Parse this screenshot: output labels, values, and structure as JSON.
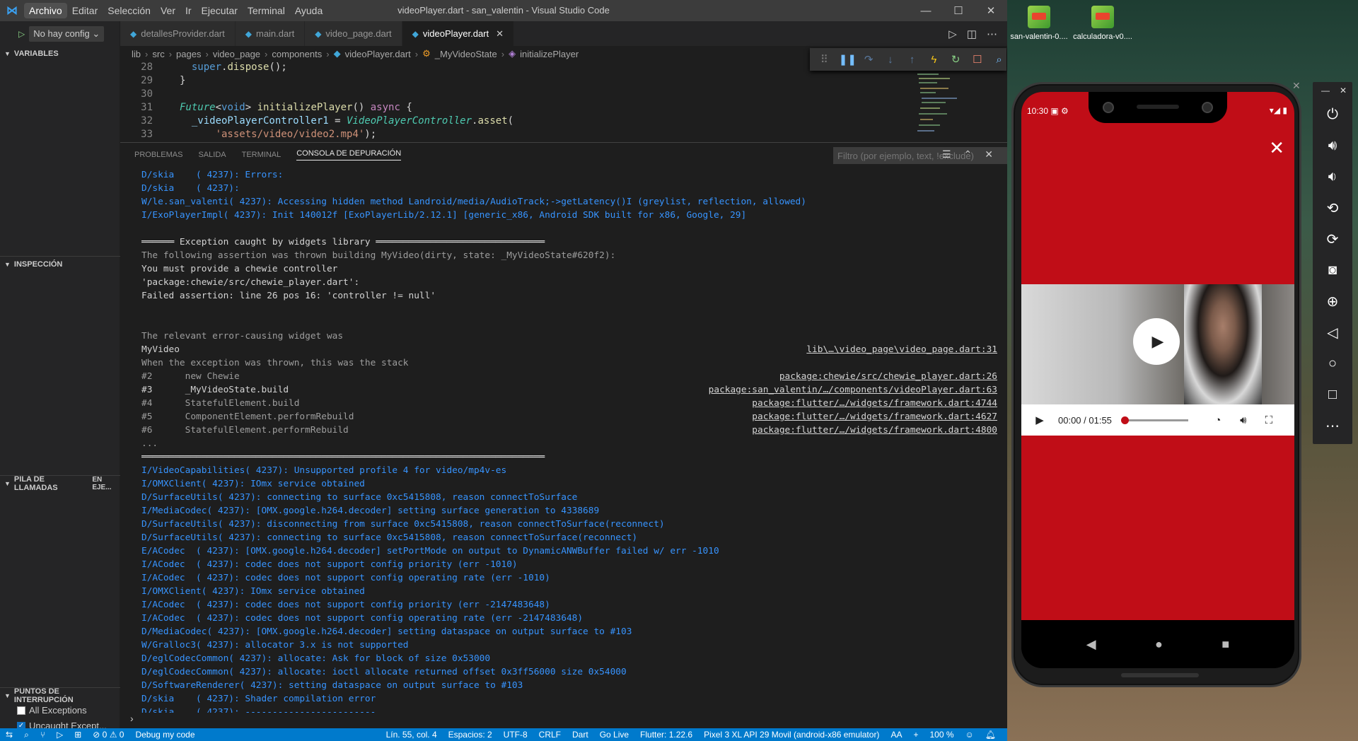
{
  "window": {
    "title": "videoPlayer.dart - san_valentin - Visual Studio Code",
    "menu": [
      "Archivo",
      "Editar",
      "Selección",
      "Ver",
      "Ir",
      "Ejecutar",
      "Terminal",
      "Ayuda"
    ],
    "controls": [
      "—",
      "☐",
      "✕"
    ]
  },
  "debug_config": {
    "label": "No hay config"
  },
  "tabs": [
    {
      "label": "detallesProvider.dart",
      "active": false
    },
    {
      "label": "main.dart",
      "active": false
    },
    {
      "label": "video_page.dart",
      "active": false
    },
    {
      "label": "videoPlayer.dart",
      "active": true
    }
  ],
  "breadcrumb": [
    "lib",
    "src",
    "pages",
    "video_page",
    "components",
    "videoPlayer.dart",
    "_MyVideoState",
    "initializePlayer"
  ],
  "sidebar": {
    "variables": "VARIABLES",
    "inspection": "INSPECCIÓN",
    "callstack": "PILA DE LLAMADAS",
    "callstack_state": "EN EJE...",
    "breakpoints": "PUNTOS DE INTERRUPCIÓN",
    "bp_items": [
      {
        "label": "All Exceptions",
        "checked": false
      },
      {
        "label": "Uncaught Except...",
        "checked": true
      }
    ]
  },
  "code": {
    "line_numbers": [
      "28",
      "29",
      "30",
      "31",
      "32",
      "33"
    ]
  },
  "panel": {
    "tabs": [
      "PROBLEMAS",
      "SALIDA",
      "TERMINAL",
      "CONSOLA DE DEPURACIÓN"
    ],
    "filter_placeholder": "Filtro (por ejemplo, text, !exclude)",
    "lines": [
      {
        "text": "D/skia    ( 4237): Errors:",
        "color": "blue"
      },
      {
        "text": "D/skia    ( 4237):",
        "color": "blue"
      },
      {
        "text": "W/le.san_valenti( 4237): Accessing hidden method Landroid/media/AudioTrack;->getLatency()I (greylist, reflection, allowed)",
        "color": "blue"
      },
      {
        "text": "I/ExoPlayerImpl( 4237): Init 140012f [ExoPlayerLib/2.12.1] [generic_x86, Android SDK built for x86, Google, 29]",
        "color": "blue"
      },
      {
        "text": "",
        "color": "grey"
      },
      {
        "text": "══════ Exception caught by widgets library ═══════════════════════════════",
        "color": "white"
      },
      {
        "text": "The following assertion was thrown building MyVideo(dirty, state: _MyVideoState#620f2):",
        "color": "grey"
      },
      {
        "text": "You must provide a chewie controller",
        "color": "white"
      },
      {
        "text": "'package:chewie/src/chewie_player.dart':",
        "color": "white"
      },
      {
        "text": "Failed assertion: line 26 pos 16: 'controller != null'",
        "color": "white"
      },
      {
        "text": "",
        "color": "grey"
      },
      {
        "text": "",
        "color": "grey"
      },
      {
        "text": "The relevant error-causing widget was",
        "color": "grey"
      },
      {
        "text": "MyVideo",
        "color": "white",
        "link": "lib\\…\\video_page\\video_page.dart:31"
      },
      {
        "text": "When the exception was thrown, this was the stack",
        "color": "grey"
      },
      {
        "text": "#2      new Chewie",
        "color": "grey",
        "link": "package:chewie/src/chewie_player.dart:26"
      },
      {
        "text": "#3      _MyVideoState.build",
        "color": "white",
        "link": "package:san_valentin/…/components/videoPlayer.dart:63"
      },
      {
        "text": "#4      StatefulElement.build",
        "color": "grey",
        "link": "package:flutter/…/widgets/framework.dart:4744"
      },
      {
        "text": "#5      ComponentElement.performRebuild",
        "color": "grey",
        "link": "package:flutter/…/widgets/framework.dart:4627"
      },
      {
        "text": "#6      StatefulElement.performRebuild",
        "color": "grey",
        "link": "package:flutter/…/widgets/framework.dart:4800"
      },
      {
        "text": "...",
        "color": "grey"
      },
      {
        "text": "══════════════════════════════════════════════════════════════════════════",
        "color": "white"
      },
      {
        "text": "I/VideoCapabilities( 4237): Unsupported profile 4 for video/mp4v-es",
        "color": "blue"
      },
      {
        "text": "I/OMXClient( 4237): IOmx service obtained",
        "color": "blue"
      },
      {
        "text": "D/SurfaceUtils( 4237): connecting to surface 0xc5415808, reason connectToSurface",
        "color": "blue"
      },
      {
        "text": "I/MediaCodec( 4237): [OMX.google.h264.decoder] setting surface generation to 4338689",
        "color": "blue"
      },
      {
        "text": "D/SurfaceUtils( 4237): disconnecting from surface 0xc5415808, reason connectToSurface(reconnect)",
        "color": "blue"
      },
      {
        "text": "D/SurfaceUtils( 4237): connecting to surface 0xc5415808, reason connectToSurface(reconnect)",
        "color": "blue"
      },
      {
        "text": "E/ACodec  ( 4237): [OMX.google.h264.decoder] setPortMode on output to DynamicANWBuffer failed w/ err -1010",
        "color": "blue"
      },
      {
        "text": "I/ACodec  ( 4237): codec does not support config priority (err -1010)",
        "color": "blue"
      },
      {
        "text": "I/ACodec  ( 4237): codec does not support config operating rate (err -1010)",
        "color": "blue"
      },
      {
        "text": "I/OMXClient( 4237): IOmx service obtained",
        "color": "blue"
      },
      {
        "text": "I/ACodec  ( 4237): codec does not support config priority (err -2147483648)",
        "color": "blue"
      },
      {
        "text": "I/ACodec  ( 4237): codec does not support config operating rate (err -2147483648)",
        "color": "blue"
      },
      {
        "text": "D/MediaCodec( 4237): [OMX.google.h264.decoder] setting dataspace on output surface to #103",
        "color": "blue"
      },
      {
        "text": "W/Gralloc3( 4237): allocator 3.x is not supported",
        "color": "blue"
      },
      {
        "text": "D/eglCodecCommon( 4237): allocate: Ask for block of size 0x53000",
        "color": "blue"
      },
      {
        "text": "D/eglCodecCommon( 4237): allocate: ioctl allocate returned offset 0x3ff56000 size 0x54000",
        "color": "blue"
      },
      {
        "text": "D/SoftwareRenderer( 4237): setting dataspace on output surface to #103",
        "color": "blue"
      },
      {
        "text": "D/skia    ( 4237): Shader compilation error",
        "color": "blue"
      },
      {
        "text": "D/skia    ( 4237): ------------------------",
        "color": "blue"
      }
    ]
  },
  "statusbar": {
    "left": [
      "⊘ 0  ⚠ 0",
      "Debug my code"
    ],
    "right": [
      "Lín. 55, col. 4",
      "Espacios: 2",
      "UTF-8",
      "CRLF",
      "Dart",
      "Go Live",
      "Flutter: 1.22.6",
      "Pixel 3 XL API 29 Movil (android-x86 emulator)",
      "AA",
      "+",
      "100 %"
    ]
  },
  "desktop": {
    "icons": [
      "san-valentin-0....",
      "calculadora-v0...."
    ]
  },
  "phone": {
    "time": "10:30",
    "video_time": "00:00 / 01:55",
    "video_progress": 0.0
  },
  "colors": {
    "accent": "#007acc",
    "app_red": "#c00d17"
  }
}
